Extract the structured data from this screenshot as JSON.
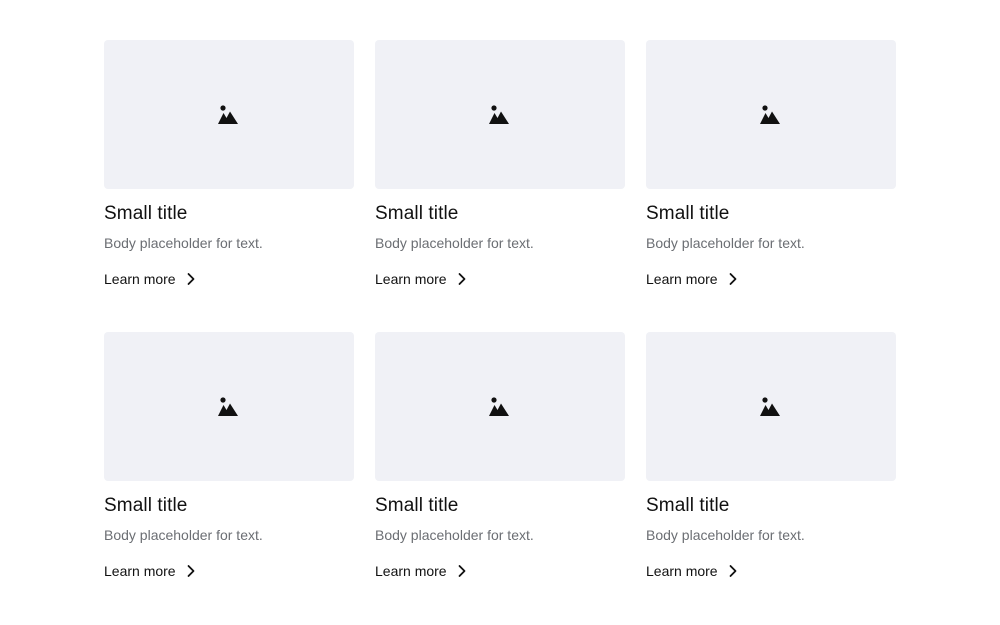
{
  "cards": [
    {
      "image_icon": "image-icon",
      "title": "Small title",
      "body": "Body placeholder for text.",
      "link_label": "Learn more",
      "link_icon": "chevron-right-icon"
    },
    {
      "image_icon": "image-icon",
      "title": "Small title",
      "body": "Body placeholder for text.",
      "link_label": "Learn more",
      "link_icon": "chevron-right-icon"
    },
    {
      "image_icon": "image-icon",
      "title": "Small title",
      "body": "Body placeholder for text.",
      "link_label": "Learn more",
      "link_icon": "chevron-right-icon"
    },
    {
      "image_icon": "image-icon",
      "title": "Small title",
      "body": "Body placeholder for text.",
      "link_label": "Learn more",
      "link_icon": "chevron-right-icon"
    },
    {
      "image_icon": "image-icon",
      "title": "Small title",
      "body": "Body placeholder for text.",
      "link_label": "Learn more",
      "link_icon": "chevron-right-icon"
    },
    {
      "image_icon": "image-icon",
      "title": "Small title",
      "body": "Body placeholder for text.",
      "link_label": "Learn more",
      "link_icon": "chevron-right-icon"
    }
  ],
  "colors": {
    "placeholder_bg": "#f0f1f6",
    "title_text": "#111111",
    "body_text": "#6b6e73"
  }
}
